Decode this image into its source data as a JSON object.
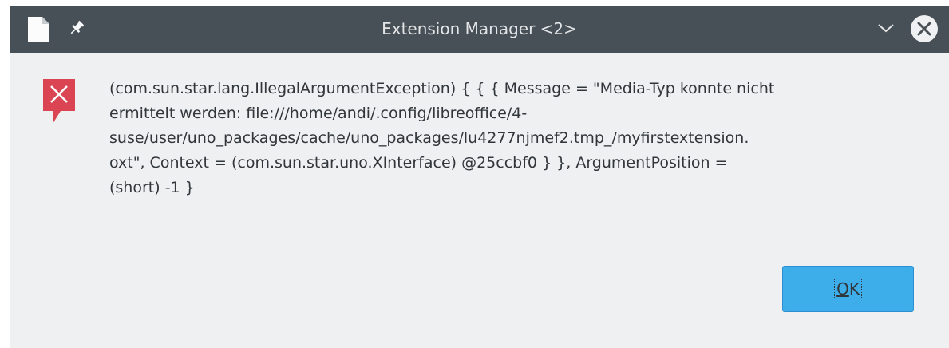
{
  "window": {
    "title": "Extension Manager <2>"
  },
  "dialog": {
    "message_lines": [
      "(com.sun.star.lang.IllegalArgumentException) { { { Message = \"Media-Typ konnte nicht",
      "ermittelt werden: file:///home/andi/.config/libreoffice/4-",
      "suse/user/uno_packages/cache/uno_packages/lu4277njmef2.tmp_/myfirstextension.",
      "oxt\", Context = (com.sun.star.uno.XInterface) @25ccbf0 } }, ArgumentPosition =",
      "(short) -1 }"
    ],
    "ok_button": {
      "mnemonic": "O",
      "rest": "K"
    }
  },
  "icons": {
    "app": "document-icon",
    "pin": "pin-icon",
    "minimize": "chevron-down-icon",
    "close": "close-icon",
    "error": "error-icon"
  },
  "colors": {
    "titlebar": "#475057",
    "window_bg": "#eff0f1",
    "error_red": "#da4453",
    "button_blue": "#3daee9"
  }
}
